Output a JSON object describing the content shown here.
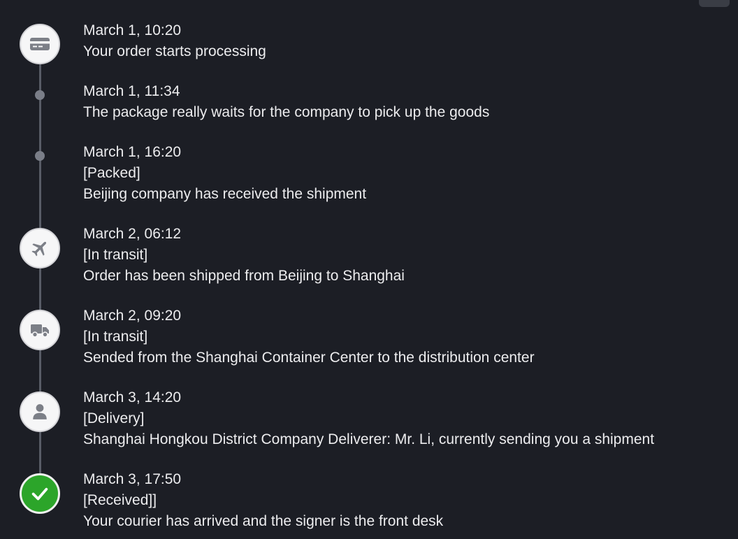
{
  "timeline": {
    "events": [
      {
        "time": "March 1, 10:20",
        "status": "",
        "description": "Your order starts processing",
        "icon": "card-icon"
      },
      {
        "time": "March 1, 11:34",
        "status": "",
        "description": "The package really waits for the company to pick up the goods",
        "icon": "dot"
      },
      {
        "time": "March 1, 16:20",
        "status": "[Packed]",
        "description": "Beijing company has received the shipment",
        "icon": "dot"
      },
      {
        "time": "March 2, 06:12",
        "status": "[In transit]",
        "description": "Order has been shipped from Beijing to Shanghai",
        "icon": "airplane-icon"
      },
      {
        "time": "March 2, 09:20",
        "status": "[In transit]",
        "description": "Sended from the Shanghai Container Center to the distribution center",
        "icon": "truck-icon"
      },
      {
        "time": "March 3, 14:20",
        "status": "[Delivery]",
        "description": "Shanghai Hongkou District Company Deliverer: Mr. Li, currently sending you a shipment",
        "icon": "person-icon"
      },
      {
        "time": "March 3, 17:50",
        "status": "[Received]]",
        "description": "Your courier has arrived and the signer is the front desk",
        "icon": "checkmark-icon"
      }
    ]
  },
  "colors": {
    "background": "#1c1e25",
    "line": "#585c66",
    "success": "#2ca52a",
    "icon": "#7c7f87"
  }
}
